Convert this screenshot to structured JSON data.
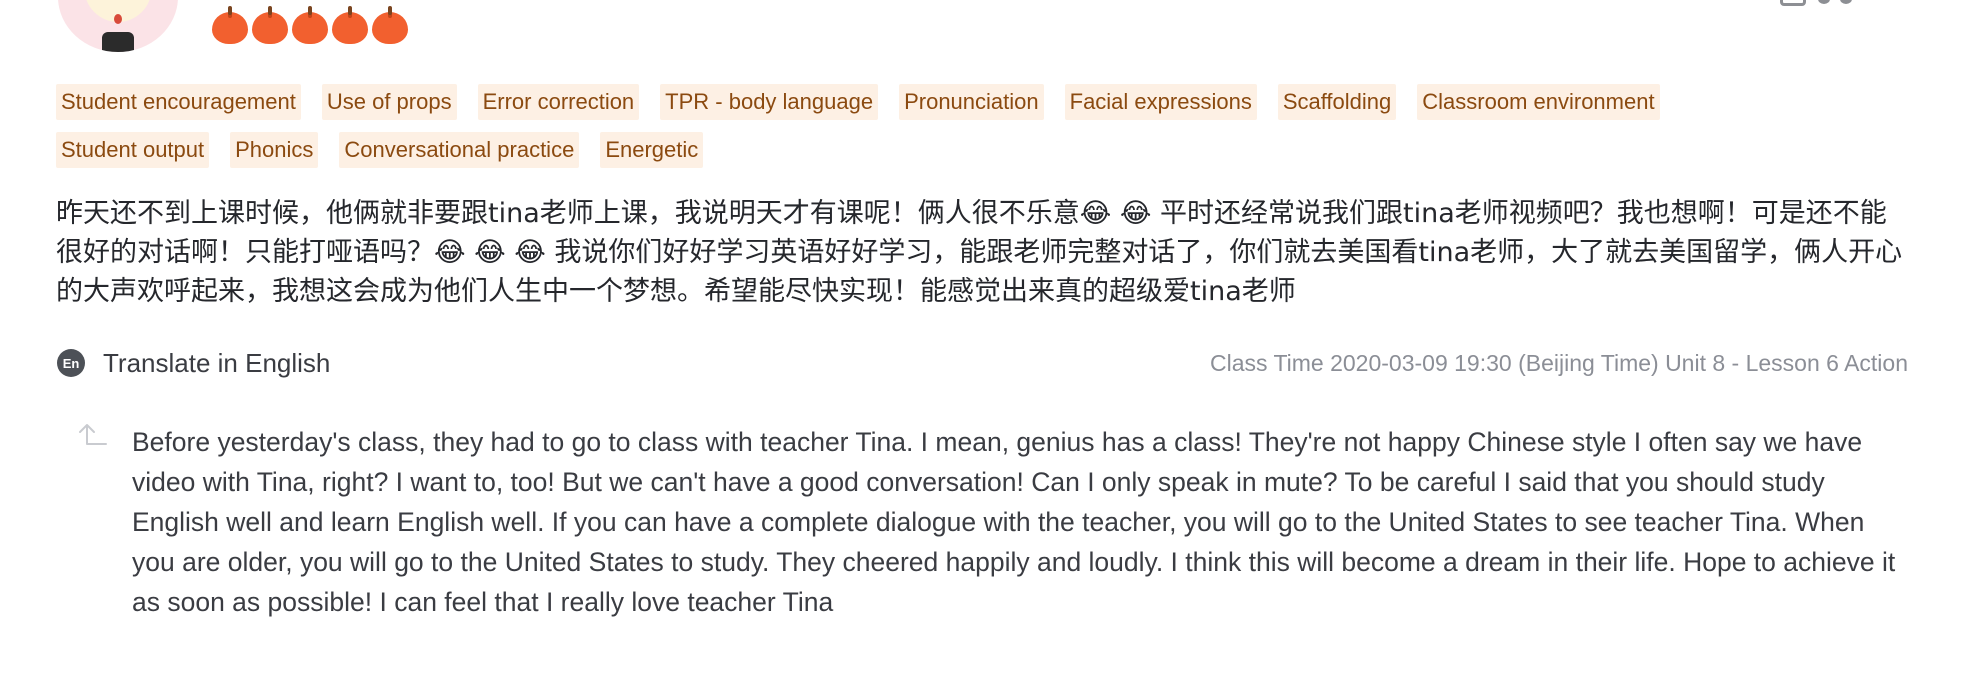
{
  "review": {
    "rating": {
      "value": 5,
      "max": 5,
      "icon": "apple-icon",
      "color": "#f2602f"
    },
    "tags": [
      "Student encouragement",
      "Use of props",
      "Error correction",
      "TPR - body language",
      "Pronunciation",
      "Facial expressions",
      "Scaffolding",
      "Classroom environment",
      "Student output",
      "Phonics",
      "Conversational practice",
      "Energetic"
    ],
    "text_zh": "昨天还不到上课时候，他俩就非要跟tina老师上课，我说明天才有课呢！俩人很不乐意😂 😂 平时还经常说我们跟tina老师视频吧？我也想啊！可是还不能很好的对话啊！只能打哑语吗？😂 😂 😂 我说你们好好学习英语好好学习，能跟老师完整对话了，你们就去美国看tina老师，大了就去美国留学，俩人开心的大声欢呼起来，我想这会成为他们人生中一个梦想。希望能尽快实现！能感觉出来真的超级爱tina老师",
    "translate_badge": "En",
    "translate_label": "Translate in English",
    "class_info": "Class Time 2020-03-09 19:30 (Beijing Time) Unit 8 - Lesson 6 Action",
    "translation": "Before yesterday's class, they had to go to class with teacher Tina. I mean, genius has a class! They're not happy Chinese style I often say we have video with Tina, right? I want to, too! But we can't have a good conversation! Can I only speak in mute? To be careful I said that you should study English well and learn English well. If you can have a complete dialogue with the teacher, you will go to the United States to see teacher Tina. When you are older, you will go to the United States to study. They cheered happily and loudly. I think this will become a dream in their life. Hope to achieve it as soon as possible! I can feel that I really love teacher Tina"
  },
  "colors": {
    "tag_bg": "#fdf0e4",
    "tag_text": "#8b4a10",
    "body_text": "#25272c",
    "muted_text": "#8b8e96"
  }
}
